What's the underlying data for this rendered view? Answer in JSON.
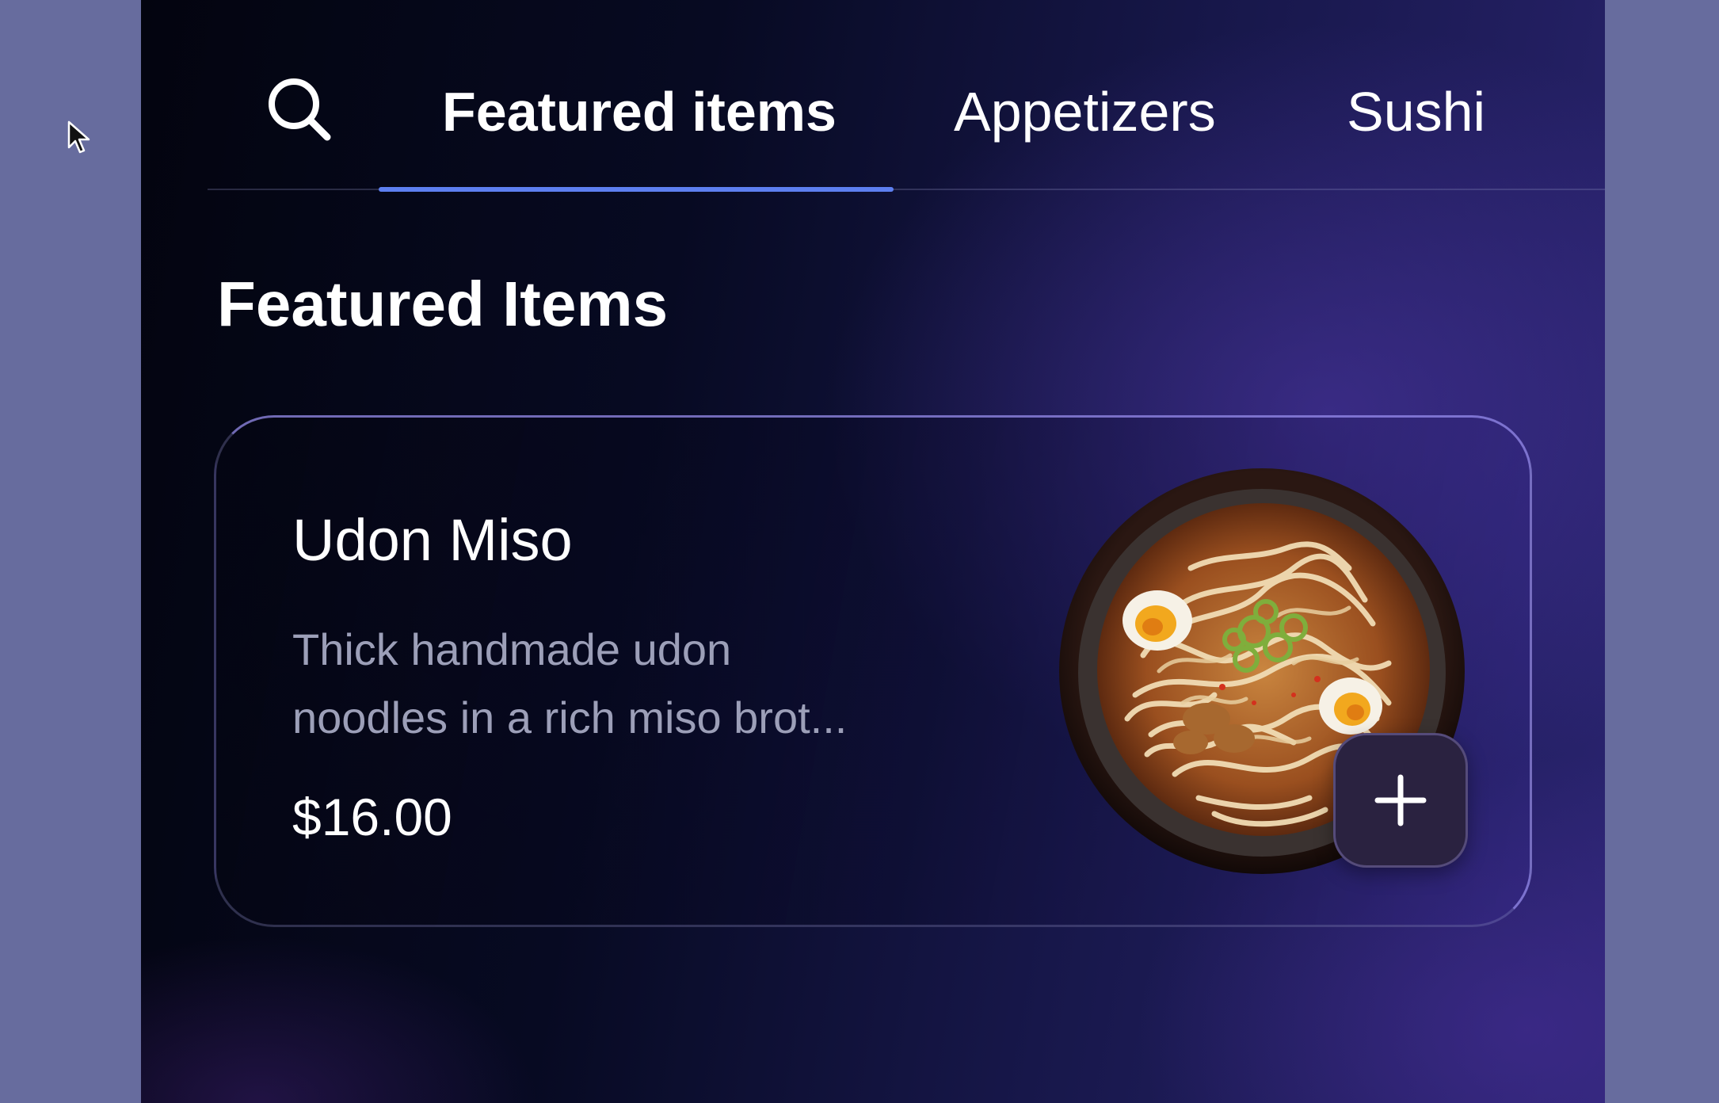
{
  "tabs": [
    {
      "label": "Featured items",
      "active": true
    },
    {
      "label": "Appetizers",
      "active": false
    },
    {
      "label": "Sushi",
      "active": false
    }
  ],
  "icons": {
    "search": "search-icon",
    "add": "plus-icon",
    "cursor": "mouse-pointer-icon"
  },
  "section": {
    "title": "Featured Items"
  },
  "featured_item": {
    "name": "Udon Miso",
    "description": "Thick handmade udon noodles in a rich miso brot...",
    "price": "$16.00",
    "image": "udon-noodle-bowl"
  },
  "colors": {
    "accent": "#5d7ff0",
    "text": "#ffffff",
    "muted_text": "#9c9fb8",
    "add_button": "#2a2240",
    "backdrop": "#676c9e"
  }
}
